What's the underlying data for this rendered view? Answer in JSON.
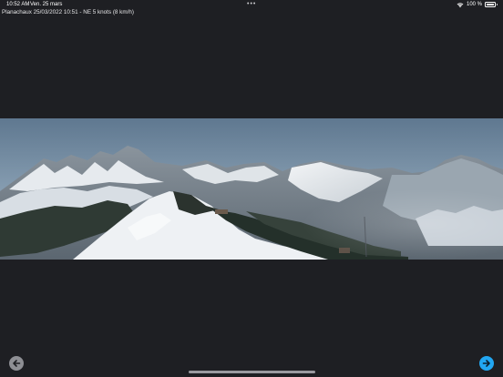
{
  "status_bar": {
    "time": "10:52 AM",
    "date": "Ven. 25 mars",
    "multitask": "•••",
    "battery_text": "100 %",
    "battery_level": 1.0
  },
  "webcam": {
    "caption": "Planachaux 25/03/2022 10:51 - NE 5 knots (8 km/h)"
  },
  "navigation": {
    "back_icon": "arrow-left-icon",
    "forward_icon": "arrow-right-icon"
  },
  "colors": {
    "background": "#1e1f23",
    "forward_accent": "#22a7f2",
    "back_button": "#8e8f94"
  }
}
